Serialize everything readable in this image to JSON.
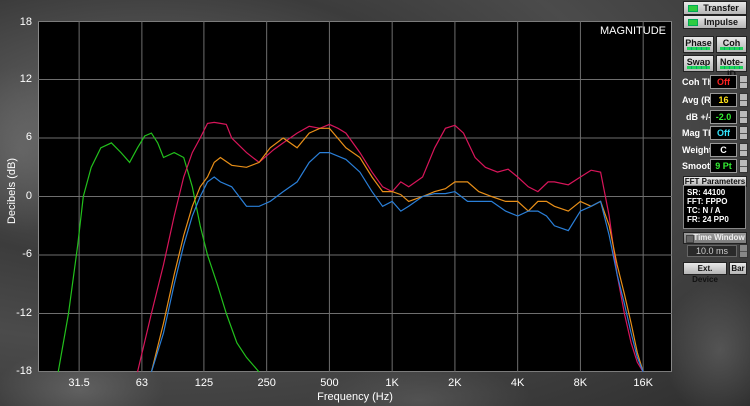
{
  "header": {
    "transfer_label": "Transfer",
    "impulse_label": "Impulse"
  },
  "plot": {
    "view_label": "MAGNITUDE",
    "y_title": "Decibels (dB)",
    "x_title": "Frequency (Hz)",
    "y_ticks": [
      "18",
      "12",
      "6",
      "0",
      "-6",
      "-12",
      "-18"
    ],
    "x_ticks": [
      "31.5",
      "63",
      "125",
      "250",
      "500",
      "1K",
      "2K",
      "4K",
      "8K",
      "16K"
    ]
  },
  "controls": {
    "phase_label": "Phase",
    "coh_label": "Coh",
    "swap_label": "Swap",
    "noteid_label": "Note-ID",
    "coh_th": {
      "label": "Coh Th",
      "value": "Off"
    },
    "avg": {
      "label": "Avg (R)",
      "value": "16"
    },
    "db": {
      "label": "dB +/-",
      "value": "-2.0"
    },
    "mag_th": {
      "label": "Mag Th",
      "value": "Off"
    },
    "weight": {
      "label": "Weight",
      "value": "C"
    },
    "smooth": {
      "label": "Smooth",
      "value": "9 Pt"
    },
    "fft_params_label": "FFT Parameters",
    "fft_lines": [
      "SR: 44100",
      "FFT: FPPO",
      "TC: N / A",
      "FR: 24 PP0"
    ],
    "time_window_label": "Time Window",
    "time_window_value": "10.0 ms",
    "ext_device_label": "Ext. Device",
    "bar_label": "Bar"
  },
  "colors": {
    "green": "#22c01c",
    "magenta": "#d8155a",
    "orange": "#e88f18",
    "blue": "#2a7fd8",
    "off_red": "#ff2222",
    "yellow": "#ffe21a",
    "cyan": "#33e6ff",
    "green_text": "#33ee33"
  },
  "chart_data": {
    "type": "line",
    "x_scale": "log",
    "xlim": [
      20,
      22000
    ],
    "ylim": [
      -18,
      18
    ],
    "series": [
      {
        "color": "green",
        "x": [
          25,
          28,
          31,
          33,
          36,
          40,
          45,
          50,
          55,
          60,
          65,
          70,
          75,
          80,
          90,
          100,
          110,
          120,
          130,
          145,
          160,
          180,
          200,
          230
        ],
        "y": [
          -18,
          -12,
          -5,
          0,
          3,
          5,
          5.5,
          4.5,
          3.5,
          5,
          6.2,
          6.5,
          5.5,
          4,
          4.5,
          4,
          1,
          -3,
          -6,
          -9,
          -12,
          -15,
          -16.5,
          -18
        ]
      },
      {
        "color": "magenta",
        "x": [
          60,
          70,
          80,
          90,
          100,
          110,
          120,
          130,
          140,
          150,
          160,
          170,
          200,
          230,
          270,
          300,
          350,
          400,
          450,
          500,
          550,
          600,
          700,
          800,
          900,
          1000,
          1100,
          1200,
          1400,
          1600,
          1800,
          2000,
          2200,
          2500,
          2800,
          3200,
          3600,
          4000,
          4500,
          5000,
          5600,
          6000,
          7000,
          8000,
          9000,
          10000,
          11000,
          12000,
          13000,
          14000,
          15000,
          16000
        ],
        "y": [
          -18,
          -12,
          -7,
          -2,
          2,
          4.5,
          6,
          7.5,
          7.6,
          7.5,
          7.4,
          6,
          4.5,
          3.5,
          4.8,
          5.5,
          6.5,
          7.2,
          7,
          7.4,
          7,
          6.5,
          4.5,
          2.5,
          1,
          0.5,
          1.5,
          1,
          2,
          5,
          7,
          7.3,
          6.5,
          4,
          3,
          2.5,
          2.8,
          2,
          1,
          0.5,
          1.5,
          1.5,
          1.2,
          2,
          2.7,
          2.5,
          -2,
          -8,
          -12,
          -15,
          -17,
          -18
        ]
      },
      {
        "color": "orange",
        "x": [
          70,
          80,
          90,
          100,
          110,
          120,
          130,
          140,
          150,
          170,
          200,
          230,
          260,
          300,
          350,
          400,
          450,
          500,
          600,
          700,
          800,
          900,
          1000,
          1100,
          1200,
          1400,
          1600,
          1800,
          2000,
          2300,
          2600,
          3000,
          3500,
          4000,
          4500,
          5000,
          5500,
          6000,
          7000,
          8000,
          9000,
          10000,
          11000,
          12000,
          13000,
          14000,
          15000,
          16000
        ],
        "y": [
          -18,
          -13,
          -8,
          -4,
          -1,
          1,
          2,
          3.5,
          4,
          3.2,
          3,
          3.5,
          5,
          6,
          5,
          6.5,
          7,
          7,
          5,
          4,
          2,
          0.5,
          0.5,
          0.2,
          -0.5,
          0,
          0.5,
          0.8,
          1.5,
          1.5,
          0.5,
          0,
          -0.5,
          -0.5,
          -1.5,
          -0.5,
          -0.5,
          -1,
          -1.5,
          -0.5,
          -1,
          -0.5,
          -3,
          -7,
          -10,
          -13,
          -16,
          -18
        ]
      },
      {
        "color": "blue",
        "x": [
          70,
          80,
          90,
          100,
          110,
          120,
          130,
          140,
          150,
          170,
          200,
          230,
          260,
          300,
          350,
          400,
          450,
          500,
          600,
          700,
          800,
          900,
          1000,
          1100,
          1200,
          1400,
          1600,
          1800,
          2000,
          2300,
          2600,
          3000,
          3500,
          4000,
          4500,
          5000,
          5500,
          6000,
          7000,
          8000,
          9000,
          10000,
          11000,
          12000,
          13000,
          14000,
          15000,
          16000
        ],
        "y": [
          -18,
          -14,
          -9,
          -5,
          -2,
          0,
          1.5,
          2,
          1.5,
          1,
          -1,
          -1,
          -0.5,
          0.5,
          1.5,
          3.5,
          4.5,
          4.5,
          3.8,
          2.5,
          0.5,
          -1,
          -0.5,
          -1.5,
          -1,
          0,
          0.3,
          0.3,
          0.5,
          -0.5,
          -0.5,
          -0.5,
          -1.5,
          -2,
          -1.5,
          -1.5,
          -2,
          -3,
          -3.5,
          -1.5,
          -1,
          -0.5,
          -4,
          -8,
          -11,
          -14,
          -16.5,
          -18
        ]
      }
    ]
  }
}
